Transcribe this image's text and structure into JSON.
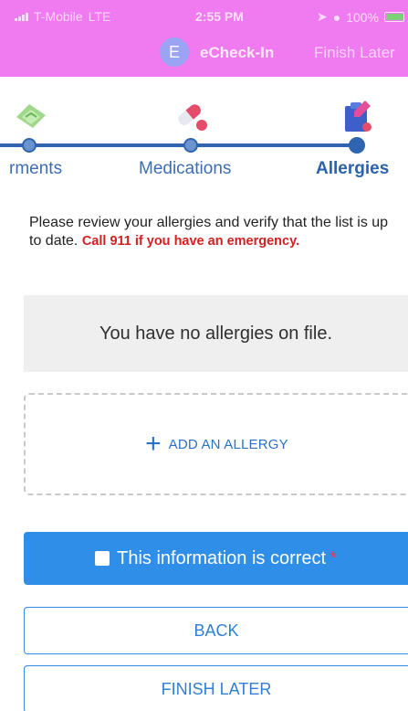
{
  "status_bar": {
    "carrier": "T-Mobile",
    "network": "LTE",
    "time": "2:55 PM",
    "battery": "100%"
  },
  "header": {
    "avatar_letter": "E",
    "title": "eCheck-In",
    "finish_link": "Finish Later"
  },
  "stepper": {
    "steps": [
      {
        "label": "rments",
        "icon": "appointments-icon",
        "state": "done"
      },
      {
        "label": "Medications",
        "icon": "pills-icon",
        "state": "done"
      },
      {
        "label": "Allergies",
        "icon": "allergy-clipboard-icon",
        "state": "active"
      }
    ]
  },
  "intro": {
    "text": "Please review your allergies and verify that the list is up to date.",
    "emergency": "Call 911 if you have an emergency."
  },
  "allergies": {
    "empty_message": "You have no allergies on file.",
    "add_label": "ADD AN ALLERGY"
  },
  "confirm": {
    "label": "This information is correct",
    "required_mark": "*"
  },
  "buttons": {
    "back": "BACK",
    "finish_later": "FINISH LATER"
  },
  "colors": {
    "header": "#f07af0",
    "primary": "#2f8ee8",
    "stepper": "#2f65b0",
    "emergency": "#d21f1f"
  }
}
